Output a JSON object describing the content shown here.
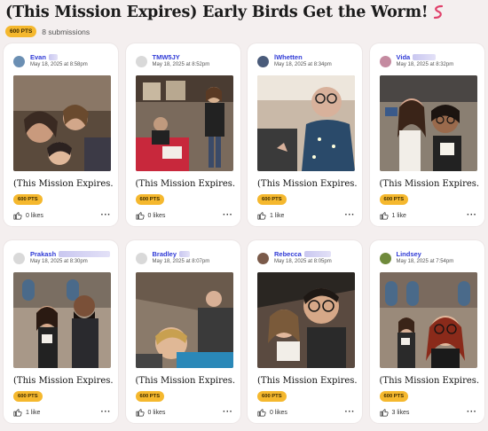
{
  "page": {
    "title": "(This Mission Expires) Early Birds Get the Worm!",
    "points_badge": "600 PTS",
    "submissions": "8 submissions"
  },
  "cards": [
    {
      "user": "Evan",
      "date": "May 18, 2025 at 8:58pm",
      "caption": "(This Mission Expires...",
      "points": "600 PTS",
      "likes": "0 likes",
      "avatar_color": "#6b8fb3",
      "blur_width": 10,
      "photo": "selfie-couch"
    },
    {
      "user": "TMW5JY",
      "date": "May 18, 2025 at 8:52pm",
      "caption": "(This Mission Expires...",
      "points": "600 PTS",
      "likes": "0 likes",
      "avatar_color": "#d9d9d9",
      "blur_width": 0,
      "photo": "booth"
    },
    {
      "user": "lWhetten",
      "date": "May 18, 2025 at 8:34pm",
      "caption": "(This Mission Expires...",
      "points": "600 PTS",
      "likes": "1 like",
      "avatar_color": "#4a5b7a",
      "blur_width": 0,
      "photo": "glasses-man"
    },
    {
      "user": "Vida",
      "date": "May 18, 2025 at 8:32pm",
      "caption": "(This Mission Expires...",
      "points": "600 PTS",
      "likes": "1 like",
      "avatar_color": "#c48aa0",
      "blur_width": 26,
      "photo": "two-women"
    },
    {
      "user": "Prakash",
      "date": "May 18, 2025 at 8:30pm",
      "caption": "(This Mission Expires...",
      "points": "600 PTS",
      "likes": "1 like",
      "avatar_color": "#d9d9d9",
      "blur_width": 58,
      "photo": "hall-pair"
    },
    {
      "user": "Bradley",
      "date": "May 18, 2025 at 8:07pm",
      "caption": "(This Mission Expires...",
      "points": "600 PTS",
      "likes": "0 likes",
      "avatar_color": "#d9d9d9",
      "blur_width": 12,
      "photo": "tilted-selfie"
    },
    {
      "user": "Rebecca",
      "date": "May 18, 2025 at 8:05pm",
      "caption": "(This Mission Expires...",
      "points": "600 PTS",
      "likes": "0 likes",
      "avatar_color": "#7a5a4a",
      "blur_width": 30,
      "photo": "tilted-pair"
    },
    {
      "user": "Lindsey",
      "date": "May 18, 2025 at 7:54pm",
      "caption": "(This Mission Expires...",
      "points": "600 PTS",
      "likes": "3 likes",
      "avatar_color": "#6f8a3b",
      "blur_width": 0,
      "photo": "windows-pair"
    }
  ]
}
